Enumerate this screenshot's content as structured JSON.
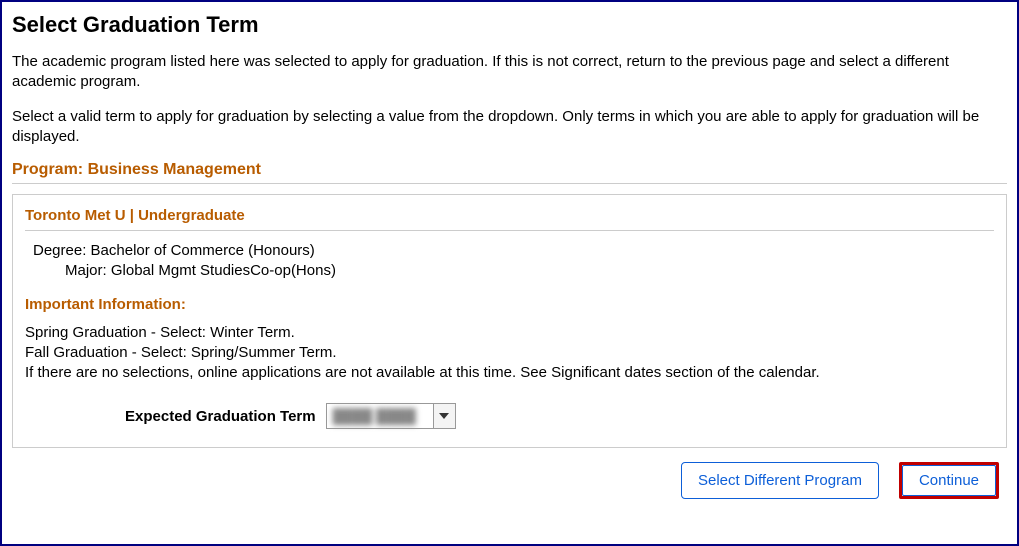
{
  "page": {
    "title": "Select Graduation Term",
    "intro1": "The academic program listed here was selected to apply for graduation. If this is not correct, return to the previous page and select a different academic program.",
    "intro2": "Select a valid term to apply for graduation by selecting a value from the dropdown. Only terms in which you are able to apply for graduation will be displayed."
  },
  "program": {
    "heading": "Program: Business Management",
    "career_heading": "Toronto Met U | Undergraduate",
    "degree_label": "Degree:",
    "degree_value": "Bachelor of Commerce (Honours)",
    "major_label": "Major:",
    "major_value": "Global Mgmt StudiesCo-op(Hons)"
  },
  "important": {
    "heading": "Important Information:",
    "line1": "Spring Graduation - Select: Winter Term.",
    "line2": "Fall Graduation - Select: Spring/Summer Term.",
    "line3": "If there are no selections, online applications are not available at this time. See Significant dates section of the calendar."
  },
  "term": {
    "label": "Expected Graduation Term",
    "selected_value": "████ ████"
  },
  "buttons": {
    "select_different": "Select Different Program",
    "continue": "Continue"
  }
}
